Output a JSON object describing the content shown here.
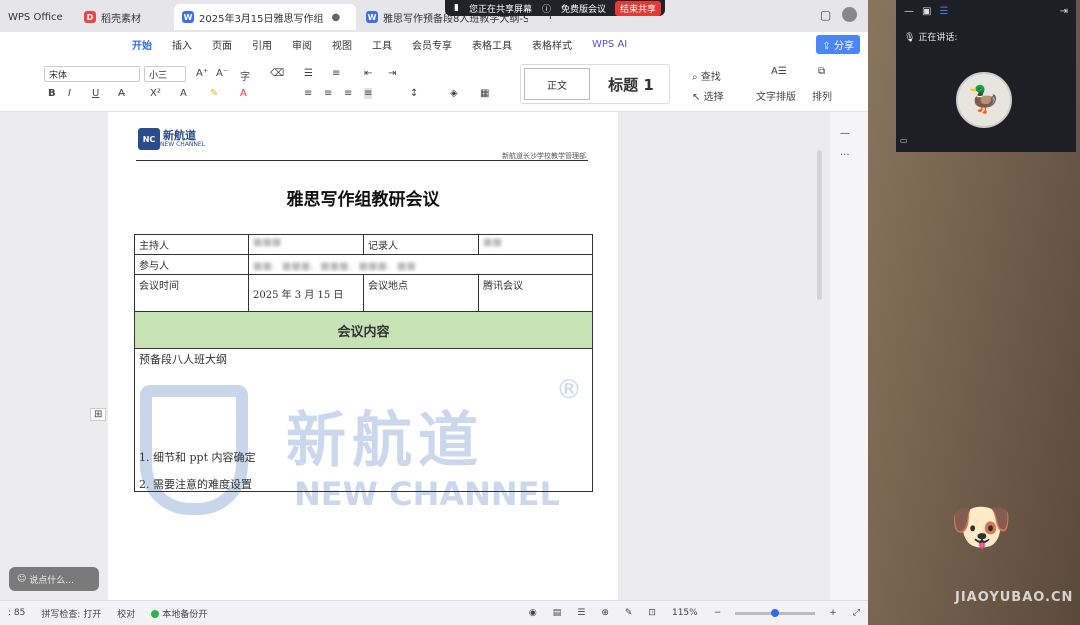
{
  "tabs": [
    {
      "label": "WPS Office"
    },
    {
      "label": "稻壳素材",
      "icon": "D"
    },
    {
      "label": "2025年3月15日雅思写作组",
      "icon": "W"
    },
    {
      "label": "雅思写作预备段8人班教学大纲-S.",
      "icon": "W"
    }
  ],
  "share_banner": {
    "sharing": "您正在共享屏幕",
    "meeting": "免费版会议",
    "stop": "结束共享"
  },
  "menu": [
    "开始",
    "插入",
    "页面",
    "引用",
    "审阅",
    "视图",
    "工具",
    "会员专享",
    "表格工具",
    "表格样式",
    "WPS AI"
  ],
  "share_button": "分享",
  "ribbon": {
    "font_name": "宋体",
    "font_size": "小三",
    "style_normal": "正文",
    "style_heading": "标题 1",
    "find": "查找",
    "select": "选择",
    "text_layout": "文字排版",
    "arrange": "排列"
  },
  "document": {
    "header_right": "新航道长沙学校教学管理部",
    "logo_cn": "新航道",
    "logo_en": "NEW CHANNEL",
    "title": "雅思写作组教研会议",
    "table": {
      "host_label": "主持人",
      "host_value": "■■■",
      "recorder_label": "记录人",
      "recorder_value": "■■",
      "participants_label": "参与人",
      "participants_value": "■■、■■■、■■■、■■■、■■",
      "time_label": "会议时间",
      "time_value": "2025 年 3 月 15 日",
      "place_label": "会议地点",
      "place_value": "腾讯会议",
      "content_header": "会议内容",
      "content_line1": "预备段八人班大纲",
      "content_line2": "1. 细节和 ppt 内容确定",
      "content_line3": "2. 需要注意的难度设置"
    },
    "watermark_cn": "新航道",
    "watermark_en": "NEW CHANNEL"
  },
  "statusbar": {
    "page": ": 85",
    "spellcheck": "拼写检查: 打开",
    "proof": "校对",
    "backup": "本地备份开",
    "zoom": "115%"
  },
  "chat_placeholder": "说点什么...",
  "meeting_panel": {
    "speaking": "正在讲话:"
  },
  "site_watermark": "JIAOYUBAO.CN"
}
